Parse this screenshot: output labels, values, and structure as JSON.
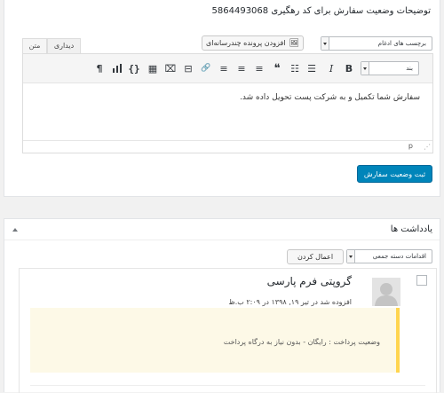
{
  "order_status": {
    "heading": "توضیحات وضعیت سفارش برای کد رهگیری 5864493068",
    "tags_select": "برچسب های ادغام",
    "add_media": "افزودن پرونده چندرسانه‌ای",
    "tabs": {
      "visual": "دیداری",
      "text": "متن"
    },
    "format_select": "بند",
    "content": "سفارش شما تکمیل و به شرکت پست تحویل داده شد.",
    "path": "p",
    "save_button": "ثبت وضعیت سفارش"
  },
  "toolbar_icons": {
    "bold": "B",
    "italic": "I",
    "bullet_list": "☰",
    "numbered_list": "☷",
    "blockquote": "❝",
    "align_left": "≡",
    "align_center": "≡",
    "align_right": "≡",
    "link": "🔗",
    "readmore": "⊟",
    "toolbar_toggle": "⌧",
    "table": "▦",
    "code": "{}",
    "chart": "▮",
    "rtl": "¶"
  },
  "notes": {
    "title": "یادداشت ها",
    "bulk_actions": "اقدامات دسته جمعی",
    "apply_button": "اعمال کردن",
    "items": [
      {
        "author": "گروپتی فرم پارسی",
        "date": "افزوده شد در تیر ۱۹, ۱۳۹۸ در ۲:۰۹ ب.ظ",
        "text": "وضعیت پرداخت : رایگان - بدون نیاز به درگاه پرداخت"
      }
    ]
  },
  "colors": {
    "primary_button": "#0085ba",
    "note_background": "#fdf9e7",
    "note_border": "#ffd54f"
  }
}
